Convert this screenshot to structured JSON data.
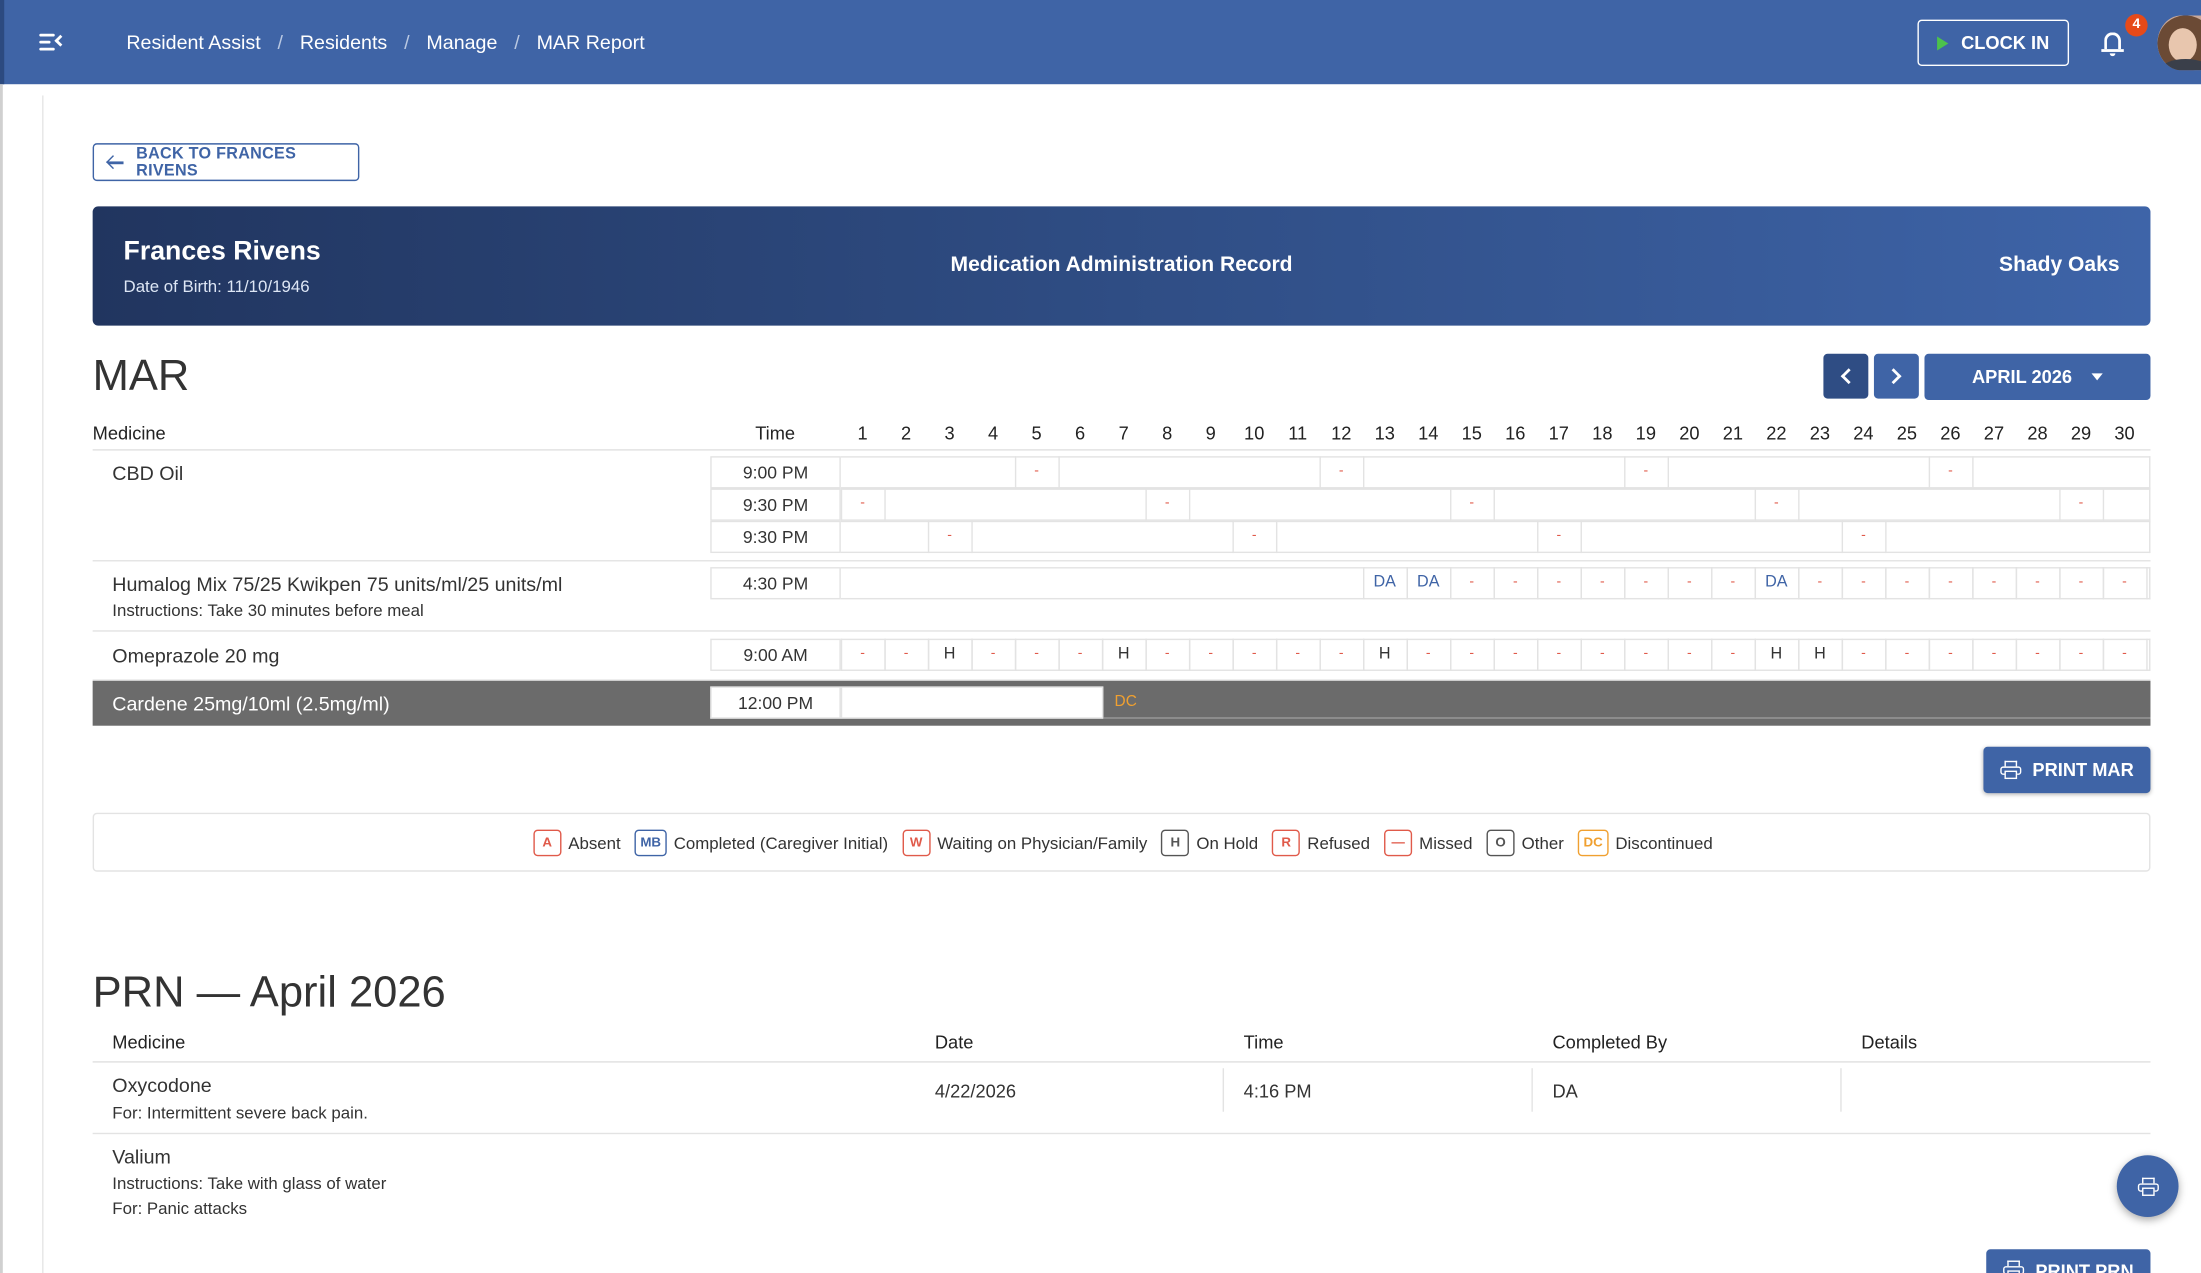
{
  "header": {
    "breadcrumbs": [
      "Resident Assist",
      "Residents",
      "Manage",
      "MAR Report"
    ],
    "clock_label": "CLOCK IN",
    "notification_count": "4"
  },
  "back_label": "BACK TO FRANCES RIVENS",
  "banner": {
    "name": "Frances Rivens",
    "dob": "Date of Birth: 11/10/1946",
    "title": "Medication Administration Record",
    "facility": "Shady Oaks"
  },
  "mar": {
    "heading": "MAR",
    "month_label": "APRIL 2026",
    "col_medicine": "Medicine",
    "col_time": "Time",
    "days": [
      "1",
      "2",
      "3",
      "4",
      "5",
      "6",
      "7",
      "8",
      "9",
      "10",
      "11",
      "12",
      "13",
      "14",
      "15",
      "16",
      "17",
      "18",
      "19",
      "20",
      "21",
      "22",
      "23",
      "24",
      "25",
      "26",
      "27",
      "28",
      "29",
      "30"
    ],
    "rows": [
      {
        "name": "CBD Oil",
        "instructions": "",
        "times": [
          {
            "time": "9:00 PM",
            "marks": [
              "",
              "",
              "",
              "",
              "-",
              "",
              "",
              "",
              "",
              "",
              "",
              "-",
              "",
              "",
              "",
              "",
              "",
              "",
              "-",
              "",
              "",
              "",
              "",
              "",
              "",
              "-",
              "",
              "",
              "",
              ""
            ]
          },
          {
            "time": "9:30 PM",
            "marks": [
              "-",
              "",
              "",
              "",
              "",
              "",
              "",
              "-",
              "",
              "",
              "",
              "",
              "",
              "",
              "-",
              "",
              "",
              "",
              "",
              "",
              "",
              "-",
              "",
              "",
              "",
              "",
              "",
              "",
              "-",
              ""
            ]
          },
          {
            "time": "9:30 PM",
            "marks": [
              "",
              "",
              "-",
              "",
              "",
              "",
              "",
              "",
              "",
              "-",
              "",
              "",
              "",
              "",
              "",
              "",
              "-",
              "",
              "",
              "",
              "",
              "",
              "",
              "-",
              "",
              "",
              "",
              "",
              "",
              ""
            ]
          }
        ]
      },
      {
        "name": "Humalog Mix 75/25 Kwikpen 75 units/ml/25 units/ml",
        "instructions": "Instructions: Take 30 minutes before meal",
        "times": [
          {
            "time": "4:30 PM",
            "marks": [
              "",
              "",
              "",
              "",
              "",
              "",
              "",
              "",
              "",
              "",
              "",
              "",
              "DA",
              "DA",
              "-",
              "-",
              "-",
              "-",
              "-",
              "-",
              "-",
              "DA",
              "-",
              "-",
              "-",
              "-",
              "-",
              "-",
              "-",
              "-"
            ]
          }
        ]
      },
      {
        "name": "Omeprazole 20 mg",
        "instructions": "",
        "times": [
          {
            "time": "9:00 AM",
            "marks": [
              "-",
              "-",
              "H",
              "-",
              "-",
              "-",
              "H",
              "-",
              "-",
              "-",
              "-",
              "-",
              "H",
              "-",
              "-",
              "-",
              "-",
              "-",
              "-",
              "-",
              "-",
              "H",
              "H",
              "-",
              "-",
              "-",
              "-",
              "-",
              "-",
              "-"
            ]
          }
        ]
      },
      {
        "name": "Cardene 25mg/10ml (2.5mg/ml)",
        "instructions": "",
        "discontinued": true,
        "times": [
          {
            "time": "12:00 PM",
            "dc_label": "DC"
          }
        ]
      }
    ],
    "print_label": "PRINT MAR"
  },
  "legend": [
    {
      "code": "A",
      "label": "Absent",
      "color": "#e05a4a"
    },
    {
      "code": "MB",
      "label": "Completed (Caregiver Initial)",
      "color": "#3f64a6"
    },
    {
      "code": "W",
      "label": "Waiting on Physician/Family",
      "color": "#e05a4a"
    },
    {
      "code": "H",
      "label": "On Hold",
      "color": "#555555"
    },
    {
      "code": "R",
      "label": "Refused",
      "color": "#e05a4a"
    },
    {
      "code": "—",
      "label": "Missed",
      "color": "#e05a4a"
    },
    {
      "code": "O",
      "label": "Other",
      "color": "#555555"
    },
    {
      "code": "DC",
      "label": "Discontinued",
      "color": "#f0a030"
    }
  ],
  "prn": {
    "heading": "PRN — April 2026",
    "columns": [
      "Medicine",
      "Date",
      "Time",
      "Completed By",
      "Details"
    ],
    "rows": [
      {
        "name": "Oxycodone",
        "lines": [
          "For: Intermittent severe back pain."
        ],
        "date": "4/22/2026",
        "time": "4:16 PM",
        "completed_by": "DA",
        "details": ""
      },
      {
        "name": "Valium",
        "lines": [
          "Instructions: Take with glass of water",
          "For: Panic attacks"
        ]
      }
    ],
    "print_label": "PRINT PRN"
  },
  "colors": {
    "primary": "#3f64a6",
    "dark": "#2f4d84",
    "missed": "#e05a4a",
    "discontinued": "#f0a030"
  }
}
